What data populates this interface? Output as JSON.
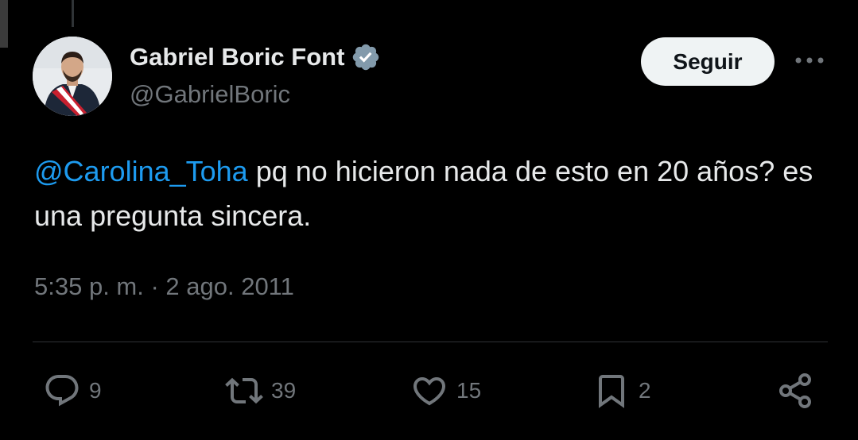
{
  "tweet": {
    "author": {
      "display_name": "Gabriel Boric Font",
      "handle": "@GabrielBoric",
      "verified_icon": "verified-badge-icon"
    },
    "follow_label": "Seguir",
    "more_icon": "more-dots-icon",
    "text": {
      "mention": "@Carolina_Toha",
      "body": " pq no hicieron nada de esto en 20 años? es una pregunta sincera."
    },
    "timestamp": "5:35 p. m. · 2 ago. 2011",
    "stats": {
      "replies": "9",
      "retweets": "39",
      "likes": "15",
      "bookmarks": "2"
    }
  },
  "colors": {
    "background": "#000000",
    "text": "#e7e9ea",
    "secondary": "#71767b",
    "mention": "#1d9bf0",
    "verified": "#829aab",
    "button_bg": "#eff3f4"
  }
}
